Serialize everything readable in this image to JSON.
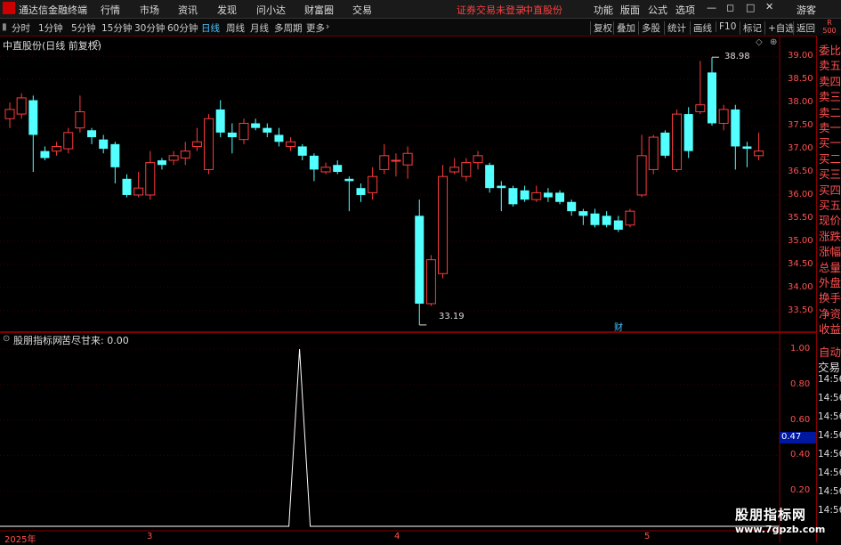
{
  "menu": {
    "app_title": "通达信金融终端",
    "items": [
      "行情",
      "市场",
      "资讯",
      "发现",
      "问小达",
      "财富圈",
      "交易"
    ],
    "status_login": "证券交易未登录",
    "stock_name": "中直股份",
    "right_items": [
      "功能",
      "版面",
      "公式",
      "选项"
    ],
    "user": "游客"
  },
  "periods": [
    "分时",
    "1分钟",
    "5分钟",
    "15分钟",
    "30分钟",
    "60分钟",
    "日线",
    "周线",
    "月线",
    "多周期",
    "更多"
  ],
  "selected_period": "日线",
  "tools": [
    "复权",
    "叠加",
    "多股",
    "统计",
    "画线",
    "F10",
    "标记",
    "+自选",
    "返回"
  ],
  "main_chart": {
    "title": "中直股份(日线 前复权)",
    "high_label": "38.98",
    "low_label": "33.19",
    "cai_marker": "财"
  },
  "indicator": {
    "source": "股朋指标网",
    "name": "苦尽甘来: 0.00"
  },
  "right_panel": {
    "badge_top": "R",
    "badge_bottom": "500",
    "labels": [
      "委比",
      "卖五",
      "卖四",
      "卖三",
      "卖二",
      "卖一",
      "买一",
      "买二",
      "买三",
      "买四",
      "买五",
      "现价",
      "涨跌",
      "涨幅",
      "总量",
      "外盘",
      "换手",
      "净资",
      "收益"
    ],
    "auto": "自动",
    "trade": "交易",
    "times": [
      "14:56",
      "14:56",
      "14:56",
      "14:56",
      "14:56",
      "14:56",
      "14:56",
      "14:56"
    ]
  },
  "y_axis_main": [
    "39.00",
    "38.50",
    "38.00",
    "37.50",
    "37.00",
    "36.50",
    "36.00",
    "35.50",
    "35.00",
    "34.50",
    "34.00",
    "33.50"
  ],
  "y_axis_indicator": [
    "1.00",
    "0.80",
    "0.60",
    "0.40",
    "0.20"
  ],
  "indicator_current_value": "0.47",
  "x_axis": [
    "2025年",
    "3",
    "4",
    "5"
  ],
  "watermark": {
    "line1": "股朋指标网",
    "line2": "www.7gpzb.com"
  },
  "colors": {
    "up": "#ff3c3c",
    "down": "#54ffff",
    "bg": "#000000",
    "axis": "#ff5050"
  },
  "chart_data": {
    "type": "candlestick",
    "price_range": [
      33.1,
      39.1
    ],
    "candles": [
      [
        37.65,
        37.85,
        38.0,
        37.45
      ],
      [
        37.75,
        38.1,
        38.2,
        37.65
      ],
      [
        38.05,
        37.3,
        38.15,
        36.5
      ],
      [
        36.95,
        36.8,
        37.05,
        36.75
      ],
      [
        36.95,
        37.05,
        37.15,
        36.85
      ],
      [
        37.0,
        37.35,
        37.45,
        36.9
      ],
      [
        37.45,
        37.8,
        38.15,
        37.35
      ],
      [
        37.4,
        37.25,
        37.45,
        37.1
      ],
      [
        37.2,
        37.0,
        37.3,
        36.9
      ],
      [
        37.1,
        36.6,
        37.15,
        36.25
      ],
      [
        36.35,
        36.0,
        36.45,
        35.95
      ],
      [
        36.0,
        36.15,
        36.5,
        35.95
      ],
      [
        36.0,
        36.7,
        36.95,
        35.9
      ],
      [
        36.75,
        36.65,
        36.8,
        36.55
      ],
      [
        36.75,
        36.85,
        36.95,
        36.65
      ],
      [
        36.8,
        36.95,
        37.15,
        36.65
      ],
      [
        37.05,
        37.15,
        37.45,
        36.95
      ],
      [
        36.55,
        37.65,
        37.75,
        36.45
      ],
      [
        37.85,
        37.35,
        38.05,
        37.25
      ],
      [
        37.35,
        37.25,
        37.55,
        36.9
      ],
      [
        37.2,
        37.55,
        37.65,
        37.1
      ],
      [
        37.55,
        37.45,
        37.65,
        37.4
      ],
      [
        37.45,
        37.35,
        37.55,
        37.25
      ],
      [
        37.3,
        37.15,
        37.45,
        37.05
      ],
      [
        37.05,
        37.15,
        37.25,
        36.95
      ],
      [
        37.05,
        36.85,
        37.1,
        36.75
      ],
      [
        36.85,
        36.55,
        36.9,
        36.3
      ],
      [
        36.5,
        36.6,
        36.7,
        36.45
      ],
      [
        36.65,
        36.5,
        36.75,
        36.45
      ],
      [
        36.35,
        36.3,
        36.4,
        35.65
      ],
      [
        36.15,
        36.0,
        36.25,
        35.85
      ],
      [
        36.05,
        36.4,
        36.6,
        35.9
      ],
      [
        36.55,
        36.85,
        37.1,
        36.45
      ],
      [
        36.75,
        36.75,
        36.9,
        36.4
      ],
      [
        36.65,
        36.9,
        37.05,
        36.35
      ],
      [
        35.55,
        33.65,
        35.9,
        33.19
      ],
      [
        33.65,
        34.6,
        34.7,
        33.6
      ],
      [
        34.3,
        36.4,
        36.65,
        34.2
      ],
      [
        36.5,
        36.6,
        36.8,
        36.45
      ],
      [
        36.4,
        36.7,
        36.8,
        36.3
      ],
      [
        36.7,
        36.85,
        36.95,
        36.55
      ],
      [
        36.65,
        36.15,
        36.7,
        36.05
      ],
      [
        36.2,
        36.15,
        36.3,
        35.65
      ],
      [
        36.15,
        35.8,
        36.2,
        35.75
      ],
      [
        36.1,
        35.9,
        36.2,
        35.85
      ],
      [
        35.9,
        36.05,
        36.2,
        35.85
      ],
      [
        36.05,
        35.95,
        36.15,
        35.85
      ],
      [
        36.05,
        35.85,
        36.1,
        35.8
      ],
      [
        35.85,
        35.65,
        35.9,
        35.55
      ],
      [
        35.65,
        35.55,
        35.7,
        35.35
      ],
      [
        35.6,
        35.35,
        35.7,
        35.3
      ],
      [
        35.55,
        35.35,
        35.65,
        35.3
      ],
      [
        35.45,
        35.25,
        35.55,
        35.2
      ],
      [
        35.35,
        35.65,
        35.7,
        35.3
      ],
      [
        36.0,
        36.85,
        37.3,
        35.95
      ],
      [
        36.55,
        37.25,
        37.3,
        36.45
      ],
      [
        37.35,
        36.85,
        37.4,
        36.8
      ],
      [
        36.55,
        37.75,
        37.85,
        36.5
      ],
      [
        37.75,
        36.95,
        37.9,
        36.8
      ],
      [
        37.8,
        37.95,
        38.9,
        37.75
      ],
      [
        38.65,
        37.55,
        38.98,
        37.5
      ],
      [
        37.55,
        37.85,
        37.95,
        37.4
      ],
      [
        37.85,
        37.05,
        37.95,
        36.55
      ],
      [
        37.05,
        37.0,
        37.15,
        36.6
      ],
      [
        36.85,
        36.95,
        37.35,
        36.75
      ]
    ],
    "indicator": {
      "name": "苦尽甘来",
      "ylim": [
        0,
        1.0
      ],
      "spike_at_index": 24,
      "spike_value": 1.0
    }
  }
}
